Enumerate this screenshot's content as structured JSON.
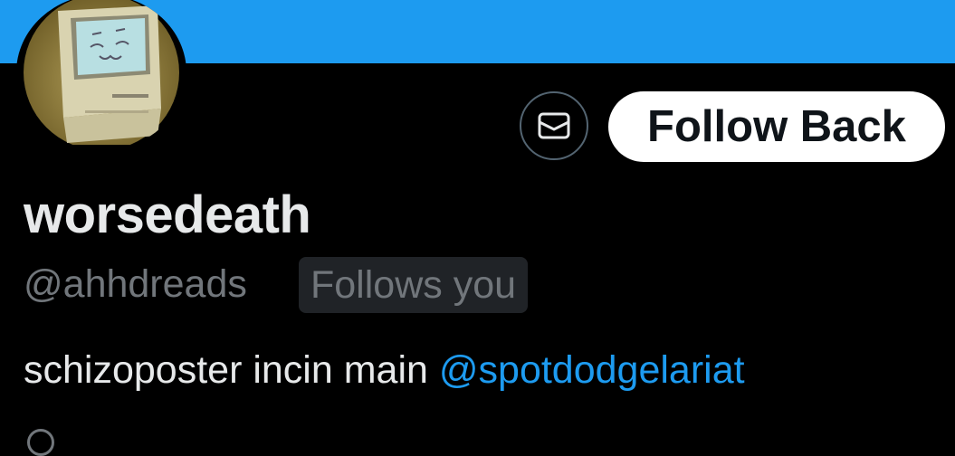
{
  "profile": {
    "display_name": "worsedeath",
    "handle": "@ahhdreads",
    "follows_you_badge": "Follows you",
    "bio_text": "schizoposter incin main ",
    "bio_mention": "@spotdodgelariat"
  },
  "actions": {
    "message_icon": "envelope-icon",
    "follow_back_label": "Follow Back"
  },
  "colors": {
    "banner": "#1d9bf0",
    "background": "#000000",
    "primary_text": "#e7e9ea",
    "secondary_text": "#71767b",
    "link": "#1d9bf0"
  }
}
